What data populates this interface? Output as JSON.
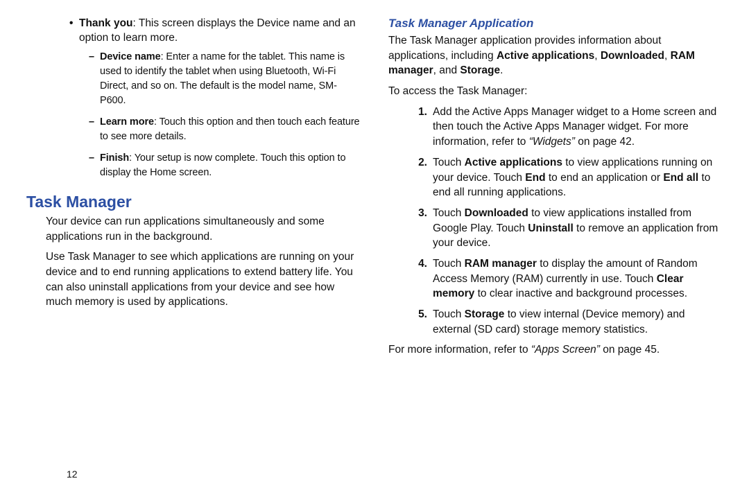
{
  "pageNumber": "12",
  "left": {
    "thankYou": {
      "label": "Thank you",
      "text": ": This screen displays the Device name and an option to learn more."
    },
    "dashes": {
      "deviceName": {
        "label": "Device name",
        "text": ": Enter a name for the tablet. This name is used to identify the tablet when using Bluetooth, Wi-Fi Direct, and so on. The default is the model name, SM-P600."
      },
      "learnMore": {
        "label": "Learn more",
        "text": ": Touch this option and then touch each feature to see more details."
      },
      "finish": {
        "label": "Finish",
        "text": ": Your setup is now complete. Touch this option to display the Home screen."
      }
    },
    "taskManagerHeading": "Task Manager",
    "tmPara1": "Your device can run applications simultaneously and some applications run in the background.",
    "tmPara2": "Use Task Manager to see which applications are running on your device and to end running applications to extend battery life. You can also uninstall applications from your device and see how much memory is used by applications."
  },
  "right": {
    "heading": "Task Manager Application",
    "intro": {
      "pre": "The Task Manager application provides information about applications, including ",
      "b1": "Active applications",
      "sep1": ", ",
      "b2": "Downloaded",
      "sep2": ", ",
      "b3": "RAM manager",
      "sep3": ", and ",
      "b4": "Storage",
      "post": "."
    },
    "access": "To access the Task Manager:",
    "steps": {
      "s1": {
        "pre": "Add the Active Apps Manager widget to a Home screen and then touch the Active Apps Manager widget. For more information, refer to ",
        "ref": "“Widgets”",
        "post": " on page 42."
      },
      "s2": {
        "a": "Touch ",
        "b1": "Active applications",
        "b": " to view applications running on your device. Touch ",
        "b2": "End",
        "c": " to end an application or ",
        "b3": "End all",
        "d": " to end all running applications."
      },
      "s3": {
        "a": "Touch ",
        "b1": "Downloaded",
        "b": " to view applications installed from Google Play. Touch ",
        "b2": "Uninstall",
        "c": " to remove an application from your device."
      },
      "s4": {
        "a": "Touch ",
        "b1": "RAM manager",
        "b": " to display the amount of Random Access Memory (RAM) currently in use. Touch ",
        "b2": "Clear memory",
        "c": " to clear inactive and background processes."
      },
      "s5": {
        "a": "Touch ",
        "b1": "Storage",
        "b": " to view internal (Device memory) and external (SD card) storage memory statistics."
      }
    },
    "outro": {
      "pre": "For more information, refer to ",
      "ref": "“Apps Screen”",
      "post": " on page 45."
    }
  }
}
